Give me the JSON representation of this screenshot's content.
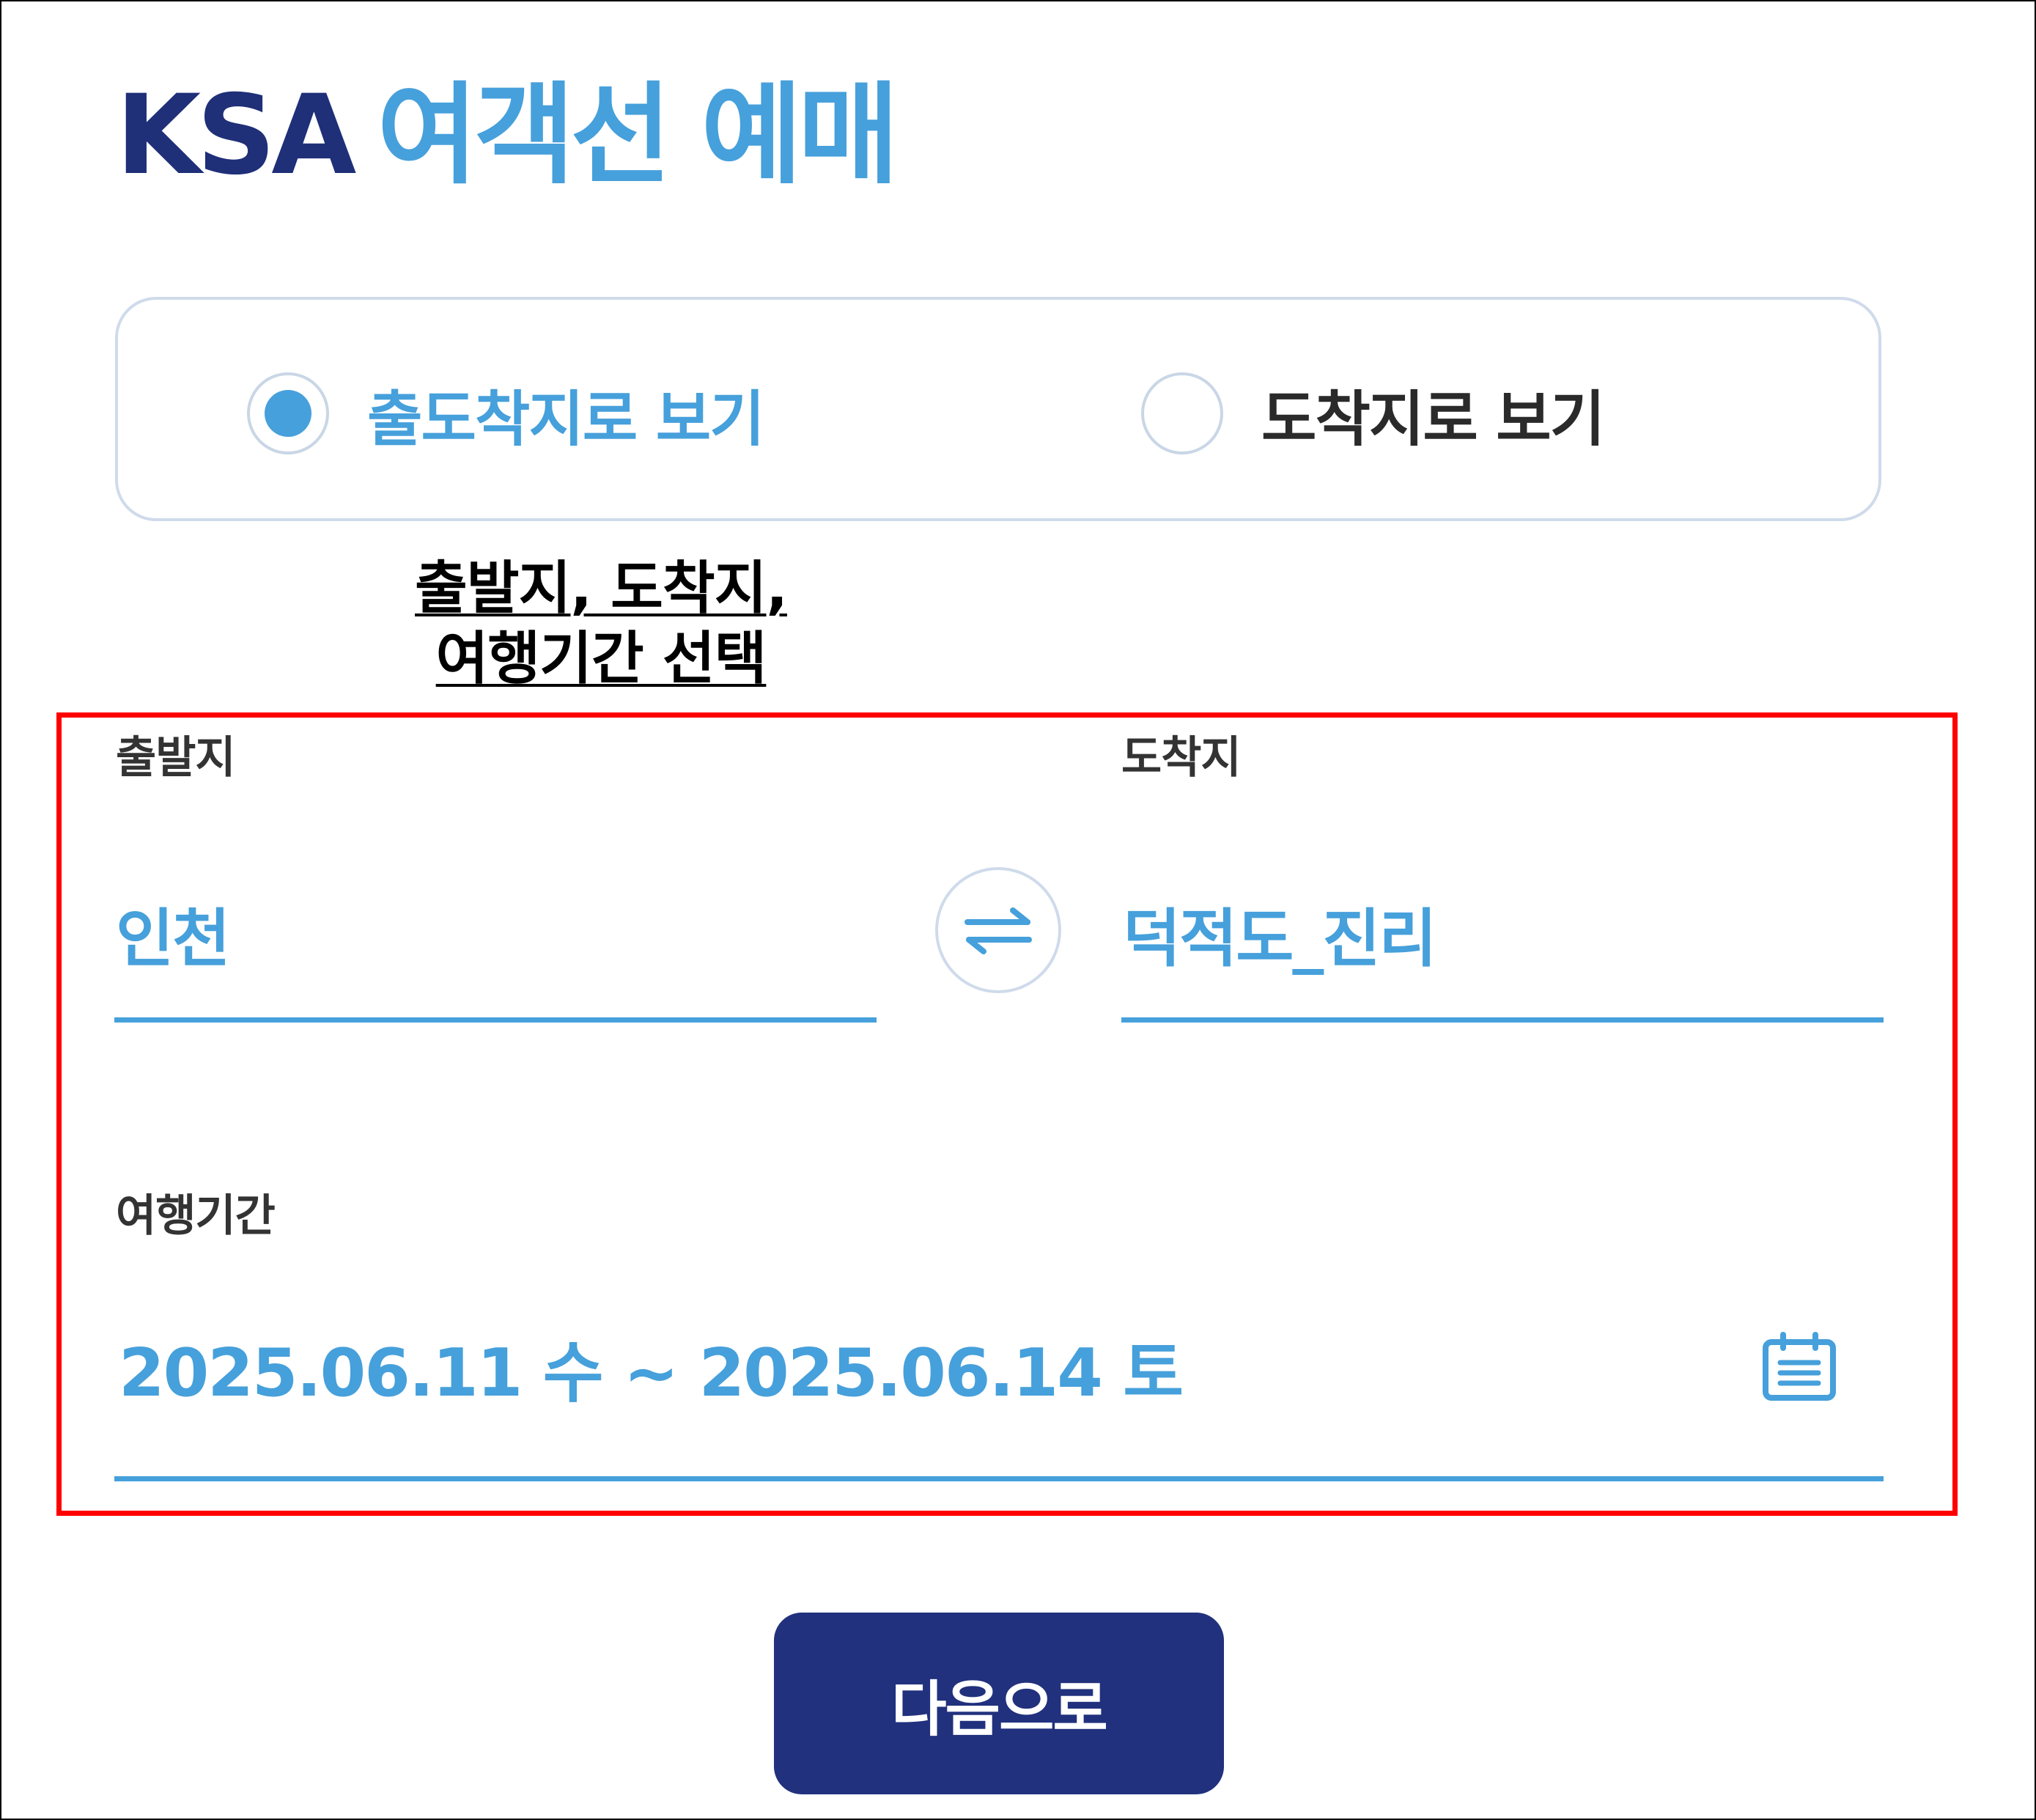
{
  "header": {
    "brand": "KSA",
    "title": "여객선 예매"
  },
  "view_mode": {
    "options": [
      {
        "label": "출도착지로 보기",
        "selected": true
      },
      {
        "label": "도착지로 보기",
        "selected": false
      }
    ]
  },
  "annotation": {
    "line1": "출발지, 도착지,",
    "line2": "여행기간 선택"
  },
  "route": {
    "departure_label": "출발지",
    "departure_value": "인천",
    "arrival_label": "도착지",
    "arrival_value": "덕적도_진리"
  },
  "period": {
    "label": "여행기간",
    "value": "2025.06.11 수 ~ 2025.06.14 토"
  },
  "actions": {
    "next_label": "다음으로"
  },
  "icons": {
    "swap": "swap-arrows-icon",
    "calendar": "calendar-icon"
  },
  "colors": {
    "brand_navy": "#1f2f78",
    "accent_blue": "#46a0db",
    "button_navy": "#21317d",
    "annotation_red": "#ff0000",
    "panel_border": "#cfdbeb"
  }
}
